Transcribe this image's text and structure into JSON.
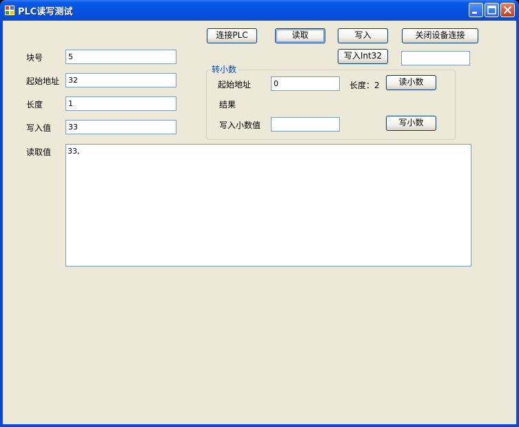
{
  "window": {
    "title": "PLC读写测试"
  },
  "toolbar": {
    "connect_label": "连接PLC",
    "read_label": "读取",
    "write_label": "写入",
    "close_conn_label": "关闭设备连接",
    "write_int32_label": "写入Int32",
    "int32_value": ""
  },
  "form": {
    "block_label": "块号",
    "block_value": "5",
    "start_label": "起始地址",
    "start_value": "32",
    "length_label": "长度",
    "length_value": "1",
    "write_value_label": "写入值",
    "write_value": "33",
    "read_value_label": "读取值",
    "read_value": "33,"
  },
  "float_group": {
    "title": "转小数",
    "start_label": "起始地址",
    "start_value": "0",
    "length_text": "长度：2",
    "read_float_label": "读小数",
    "result_label": "结果",
    "write_float_label": "写入小数值",
    "write_float_value": "",
    "write_float_button": "写小数"
  }
}
